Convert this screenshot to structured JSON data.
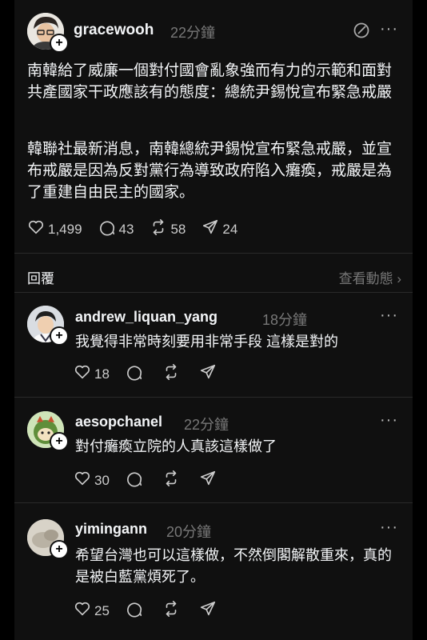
{
  "post": {
    "username": "gracewooh",
    "time": "22分鐘",
    "paragraph1": "南韓給了威廉一個對付國會亂象強而有力的示範和面對共產國家干政應該有的態度：總統尹錫悅宣布緊急戒嚴",
    "paragraph2": "韓聯社最新消息，南韓總統尹錫悅宣布緊急戒嚴，並宣布戒嚴是因為反對黨行為導致政府陷入癱瘓，戒嚴是為了重建自由民主的國家。",
    "likes": "1,499",
    "comments": "43",
    "reposts": "58",
    "shares": "24",
    "more": "···"
  },
  "replies_header": {
    "label": "回覆",
    "view_activity": "查看動態 ›"
  },
  "replies": [
    {
      "username": "andrew_liquan_yang",
      "time": "18分鐘",
      "text": "我覺得非常時刻要用非常手段 這樣是對的",
      "likes": "18",
      "more": "···"
    },
    {
      "username": "aesopchanel",
      "time": "22分鐘",
      "text": "對付癱瘓立院的人真該這樣做了",
      "likes": "30",
      "more": "···"
    },
    {
      "username": "yimingann",
      "time": "20分鐘",
      "text": "希望台灣也可以這樣做，不然倒閣解散重來，真的是被白藍黨煩死了。",
      "likes": "25",
      "more": "···"
    }
  ],
  "colors": {
    "background": "#101010",
    "text": "#f3f5f7",
    "muted": "#777777"
  },
  "icons": [
    "heart-icon",
    "comment-icon",
    "repost-icon",
    "share-icon",
    "add-follow-icon",
    "feed-icon",
    "more-icon"
  ]
}
